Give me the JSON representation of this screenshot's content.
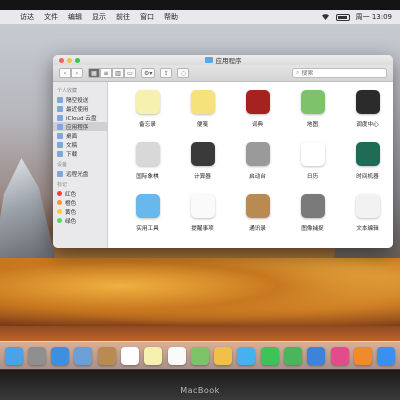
{
  "menubar": {
    "items": [
      "访达",
      "文件",
      "编辑",
      "显示",
      "前往",
      "窗口",
      "帮助"
    ],
    "clock": "周一 13:09"
  },
  "window": {
    "title": "应用程序",
    "search_placeholder": "搜索"
  },
  "sidebar": {
    "sections": [
      {
        "header": "个人收藏",
        "items": [
          "隔空投送",
          "最近使用",
          "iCloud 云盘",
          "应用程序",
          "桌面",
          "文稿",
          "下载"
        ]
      },
      {
        "header": "设备",
        "items": [
          "远程光盘"
        ]
      },
      {
        "header": "标记",
        "items": [
          "红色",
          "橙色",
          "黄色",
          "绿色"
        ]
      }
    ],
    "selected": "应用程序",
    "tag_colors": [
      "#fc3d39",
      "#fd9426",
      "#fecb2e",
      "#53d769"
    ]
  },
  "apps": [
    {
      "label": "备忘录",
      "icon": "notes-icon",
      "color": "#f7f1b0"
    },
    {
      "label": "便笺",
      "icon": "stickies-icon",
      "color": "#f6e27a"
    },
    {
      "label": "词典",
      "icon": "dictionary-icon",
      "color": "#a5221f"
    },
    {
      "label": "地图",
      "icon": "maps-icon",
      "color": "#7cc36a"
    },
    {
      "label": "调度中心",
      "icon": "mission-control-icon",
      "color": "#2b2b2b"
    },
    {
      "label": "国际象棋",
      "icon": "chess-icon",
      "color": "#d8d8d8"
    },
    {
      "label": "计算器",
      "icon": "calculator-icon",
      "color": "#3a3a3a"
    },
    {
      "label": "启动台",
      "icon": "launchpad-icon",
      "color": "#9a9a9a"
    },
    {
      "label": "日历",
      "icon": "calendar-icon",
      "color": "#ffffff"
    },
    {
      "label": "时间机器",
      "icon": "time-machine-icon",
      "color": "#1f6b55"
    },
    {
      "label": "实用工具",
      "icon": "utilities-folder-icon",
      "color": "#68b8ee"
    },
    {
      "label": "提醒事项",
      "icon": "reminders-icon",
      "color": "#fafafa"
    },
    {
      "label": "通讯录",
      "icon": "contacts-icon",
      "color": "#b98a52"
    },
    {
      "label": "图像捕捉",
      "icon": "image-capture-icon",
      "color": "#7a7a7a"
    },
    {
      "label": "文本编辑",
      "icon": "textedit-icon",
      "color": "#f2f2f2"
    }
  ],
  "dock": {
    "icons": [
      {
        "name": "finder-icon",
        "color": "#4aa3e8"
      },
      {
        "name": "launchpad-icon",
        "color": "#8f8f8f"
      },
      {
        "name": "safari-icon",
        "color": "#3f8fe0"
      },
      {
        "name": "photos-preview-icon",
        "color": "#6a9fd8"
      },
      {
        "name": "contacts-icon",
        "color": "#b98a52"
      },
      {
        "name": "calendar-icon",
        "color": "#ffffff"
      },
      {
        "name": "notes-icon",
        "color": "#f7f1b0"
      },
      {
        "name": "reminders-icon",
        "color": "#fafafa"
      },
      {
        "name": "maps-icon",
        "color": "#7cc36a"
      },
      {
        "name": "photos-icon",
        "color": "#f0c04a"
      },
      {
        "name": "messages-icon",
        "color": "#46b0f0"
      },
      {
        "name": "facetime-icon",
        "color": "#3fc25a"
      },
      {
        "name": "numbers-icon",
        "color": "#4ab55a"
      },
      {
        "name": "keynote-icon",
        "color": "#3c83d9"
      },
      {
        "name": "itunes-icon",
        "color": "#e44b8b"
      },
      {
        "name": "ibooks-icon",
        "color": "#f08a2a"
      },
      {
        "name": "app-store-icon",
        "color": "#3b8ff0"
      }
    ]
  },
  "device_label": "MacBook"
}
